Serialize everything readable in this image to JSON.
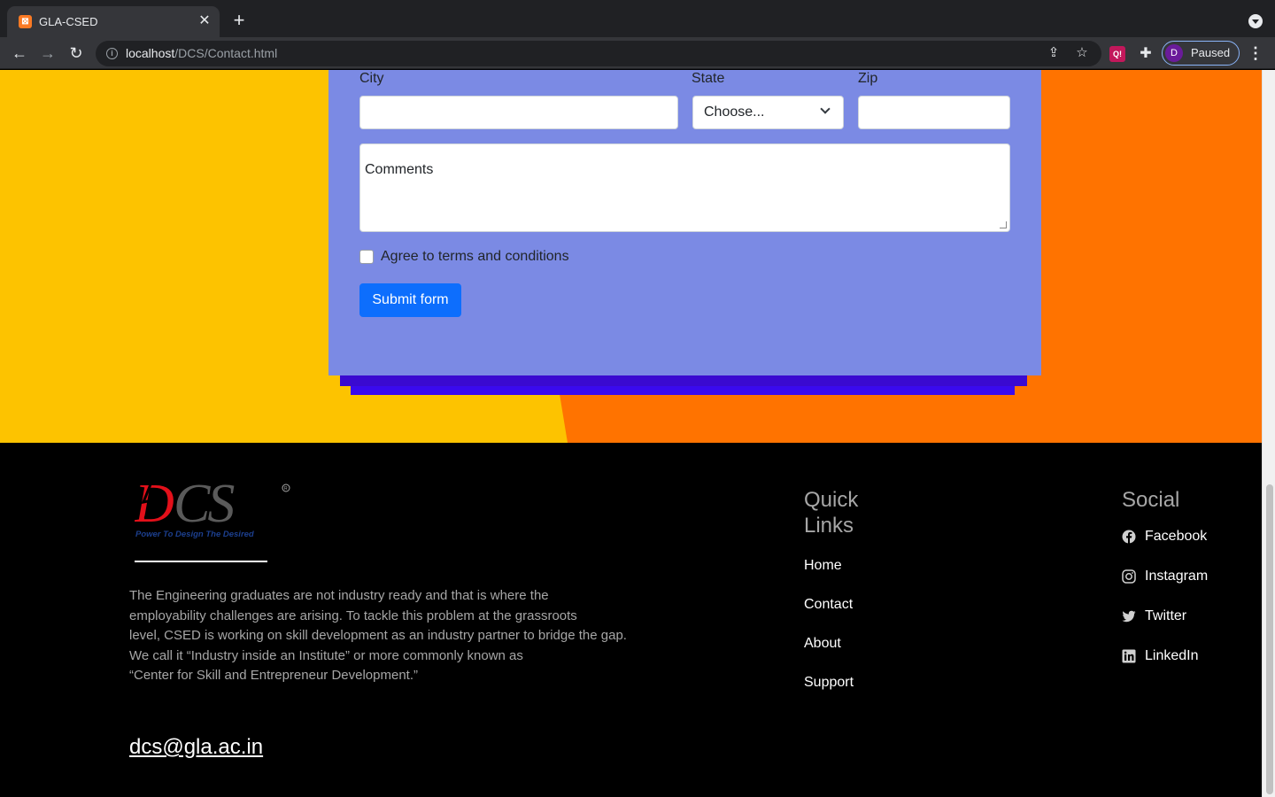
{
  "browser": {
    "tab_title": "GLA-CSED",
    "url_host": "localhost",
    "url_path": "/DCS/Contact.html",
    "profile_initial": "D",
    "profile_status": "Paused"
  },
  "form": {
    "city_label": "City",
    "city_value": "",
    "state_label": "State",
    "state_selected": "Choose...",
    "zip_label": "Zip",
    "zip_value": "",
    "comments_placeholder": "Comments",
    "terms_label": "Agree to terms and conditions",
    "terms_checked": false,
    "submit_label": "Submit form"
  },
  "footer": {
    "logo_text": "DCS",
    "logo_tagline": "Power To Design The Desired",
    "about_lines": [
      "The Engineering graduates are not industry ready and that is where the",
      "employability challenges are arising. To tackle this problem at the grassroots",
      "level, CSED is working on skill development as an industry partner to bridge the gap.",
      "We call it “Industry inside an Institute” or more commonly known as",
      "“Center for Skill and Entrepreneur Development.”"
    ],
    "email": "dcs@gla.ac.in",
    "quick_links_title": "Quick Links",
    "quick_links": [
      "Home",
      "Contact",
      "About",
      "Support"
    ],
    "social_title": "Social",
    "social_links": [
      {
        "label": "Facebook",
        "icon": "facebook-icon"
      },
      {
        "label": "Instagram",
        "icon": "instagram-icon"
      },
      {
        "label": "Twitter",
        "icon": "twitter-icon"
      },
      {
        "label": "LinkedIn",
        "icon": "linkedin-icon"
      }
    ]
  },
  "colors": {
    "hero_left": "#fdc300",
    "hero_right": "#ff7300",
    "form_card": "#7b8ae4",
    "submit_button": "#0d6efd"
  }
}
